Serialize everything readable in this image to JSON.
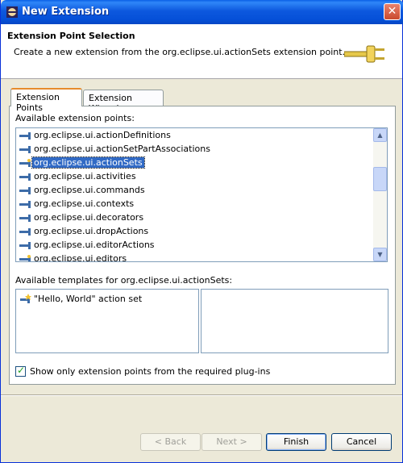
{
  "window": {
    "title": "New Extension",
    "close_glyph": "✕"
  },
  "header": {
    "title": "Extension Point Selection",
    "description": "Create a new extension from the org.eclipse.ui.actionSets extension point.",
    "icon": "plug-icon"
  },
  "tabs": [
    {
      "label": "Extension Points",
      "active": true
    },
    {
      "label": "Extension Wizards",
      "active": false
    }
  ],
  "extension_points": {
    "label": "Available extension points:",
    "items": [
      {
        "label": "org.eclipse.ui.actionDefinitions",
        "icon": "extension-point-icon"
      },
      {
        "label": "org.eclipse.ui.actionSetPartAssociations",
        "icon": "extension-point-icon"
      },
      {
        "label": "org.eclipse.ui.actionSets",
        "icon": "extension-point-template-icon",
        "selected": true
      },
      {
        "label": "org.eclipse.ui.activities",
        "icon": "extension-point-icon"
      },
      {
        "label": "org.eclipse.ui.commands",
        "icon": "extension-point-icon"
      },
      {
        "label": "org.eclipse.ui.contexts",
        "icon": "extension-point-icon"
      },
      {
        "label": "org.eclipse.ui.decorators",
        "icon": "extension-point-icon"
      },
      {
        "label": "org.eclipse.ui.dropActions",
        "icon": "extension-point-icon"
      },
      {
        "label": "org.eclipse.ui.editorActions",
        "icon": "extension-point-icon"
      },
      {
        "label": "org.eclipse.ui.editors",
        "icon": "extension-point-template-icon"
      }
    ]
  },
  "templates": {
    "label": "Available templates for org.eclipse.ui.actionSets:",
    "items": [
      {
        "label": "\"Hello, World\" action set",
        "icon": "template-icon"
      }
    ],
    "description": ""
  },
  "filter": {
    "label": "Show only extension points from the required plug-ins",
    "checked": true
  },
  "buttons": {
    "back": "< Back",
    "next": "Next >",
    "finish": "Finish",
    "cancel": "Cancel"
  },
  "colors": {
    "selection": "#316ac5",
    "titlebar": "#0550d8"
  }
}
